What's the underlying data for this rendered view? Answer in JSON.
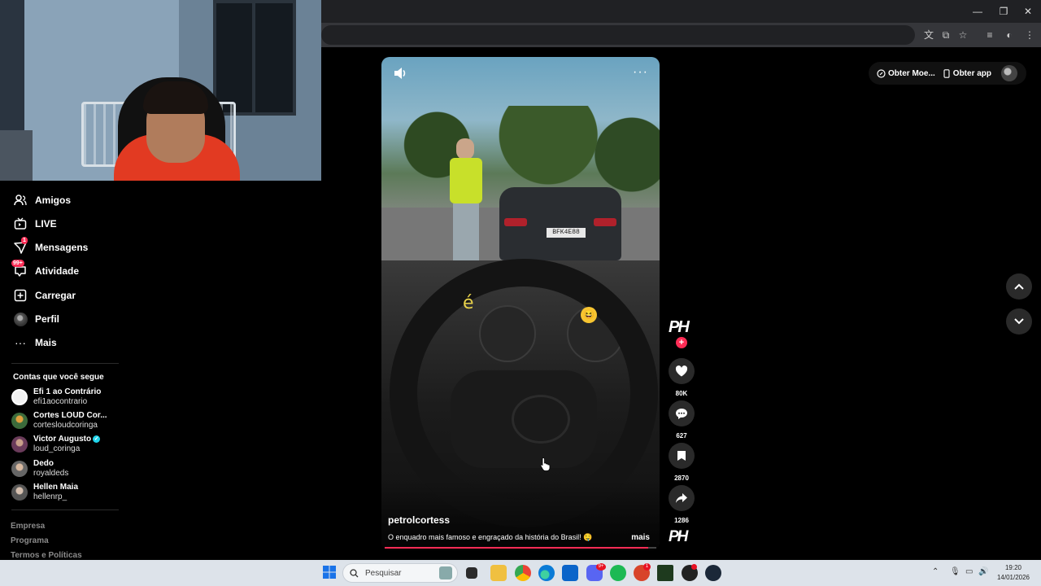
{
  "sidebar": {
    "items": [
      {
        "label": "Amigos",
        "icon": "friends-icon"
      },
      {
        "label": "LIVE",
        "icon": "live-icon"
      },
      {
        "label": "Mensagens",
        "icon": "messages-icon",
        "badge": "1"
      },
      {
        "label": "Atividade",
        "icon": "activity-icon",
        "badge": "99+"
      },
      {
        "label": "Carregar",
        "icon": "upload-icon"
      },
      {
        "label": "Perfil",
        "icon": "profile-icon"
      },
      {
        "label": "Mais",
        "icon": "more-icon"
      }
    ],
    "following_title": "Contas que você segue",
    "following": [
      {
        "name": "Efi 1 ao Contrário",
        "handle": "efi1aocontrario"
      },
      {
        "name": "Cortes LOUD Cor...",
        "handle": "cortesloudcoringa"
      },
      {
        "name": "Victor Augusto",
        "handle": "loud_coringa",
        "verified": true
      },
      {
        "name": "Dedo",
        "handle": "royaldeds"
      },
      {
        "name": "Hellen Maia",
        "handle": "hellenrp_"
      }
    ],
    "footer": [
      "Empresa",
      "Programa",
      "Termos e Políticas"
    ]
  },
  "header": {
    "get_coins": "Obter Moe...",
    "get_app": "Obter app"
  },
  "video": {
    "username": "petrolcortess",
    "caption": "O enquadro mais famoso e engraçado da história do Brasil! 🤤",
    "more": "mais",
    "plate": "BFK4E88",
    "overlay_text": "é",
    "progress": 0.97
  },
  "actions": {
    "likes": "80K",
    "comments": "627",
    "saves": "2870",
    "shares": "1286",
    "creator_logo": "PH"
  },
  "taskbar": {
    "search_placeholder": "Pesquisar",
    "time": "19:20",
    "date": "14/01/2026",
    "badges": {
      "discord": "9+",
      "messenger": "1"
    }
  },
  "colors": {
    "accent": "#fe2c55",
    "verified": "#20d5ec",
    "background": "#000000"
  }
}
